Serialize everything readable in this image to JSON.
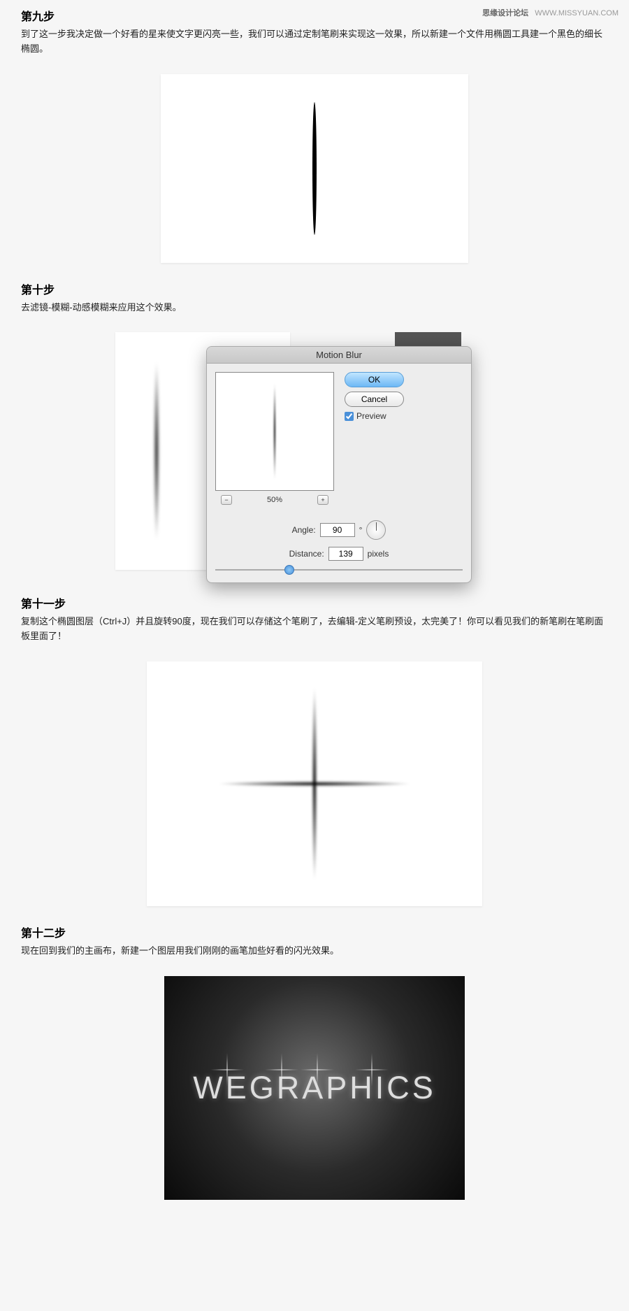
{
  "watermark": {
    "cn": "思缘设计论坛",
    "url": "WWW.MISSYUAN.COM"
  },
  "step9": {
    "title": "第九步",
    "text": "到了这一步我决定做一个好看的星来使文字更闪亮一些，我们可以通过定制笔刷来实现这一效果，所以新建一个文件用椭圆工具建一个黑色的细长椭圆。"
  },
  "step10": {
    "title": "第十步",
    "text": "去滤镜-模糊-动感模糊来应用这个效果。",
    "dialog": {
      "title": "Motion Blur",
      "ok": "OK",
      "cancel": "Cancel",
      "preview": "Preview",
      "zoom": "50%",
      "zoomMinus": "−",
      "zoomPlus": "+",
      "angleLabel": "Angle:",
      "angleValue": "90",
      "angleUnit": "°",
      "distanceLabel": "Distance:",
      "distanceValue": "139",
      "distanceUnit": "pixels"
    }
  },
  "step11": {
    "title": "第十一步",
    "text": "复制这个椭圆图层（Ctrl+J）并且旋转90度，现在我们可以存储这个笔刷了，去编辑-定义笔刷预设，太完美了！你可以看见我们的新笔刷在笔刷面板里面了！"
  },
  "step12": {
    "title": "第十二步",
    "text": "现在回到我们的主画布，新建一个图层用我们刚刚的画笔加些好看的闪光效果。",
    "resultText": "WEGRAPHICS"
  }
}
